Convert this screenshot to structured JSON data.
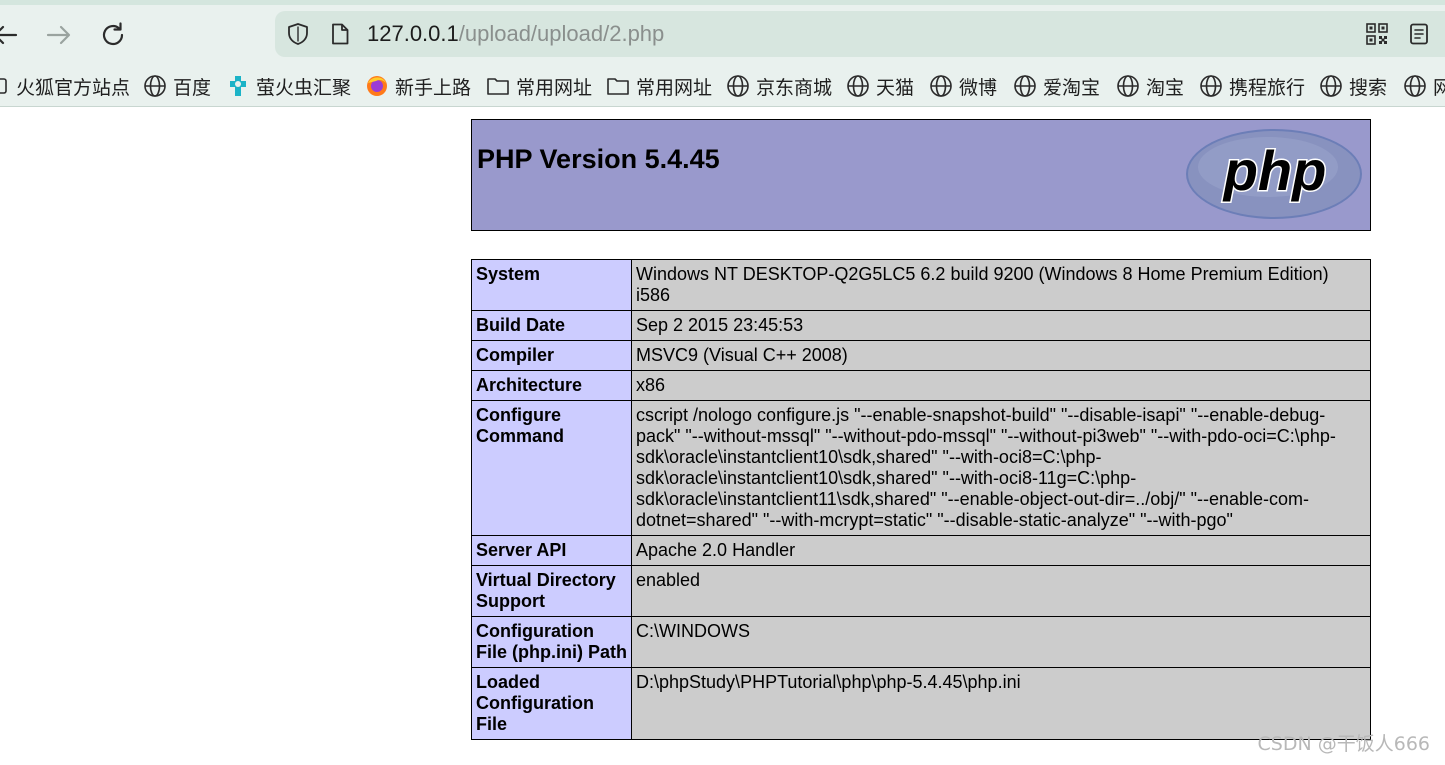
{
  "browser": {
    "url_host": "127.0.0.1",
    "url_path": "/upload/upload/2.php",
    "bookmarks": [
      {
        "label": "火狐官方站点",
        "icon": "folder-icon"
      },
      {
        "label": "百度",
        "icon": "globe-icon"
      },
      {
        "label": "萤火虫汇聚",
        "icon": "puzzle-icon"
      },
      {
        "label": "新手上路",
        "icon": "firefox-icon"
      },
      {
        "label": "常用网址",
        "icon": "folder-icon"
      },
      {
        "label": "常用网址",
        "icon": "folder-icon"
      },
      {
        "label": "京东商城",
        "icon": "globe-icon"
      },
      {
        "label": "天猫",
        "icon": "globe-icon"
      },
      {
        "label": "微博",
        "icon": "globe-icon"
      },
      {
        "label": "爱淘宝",
        "icon": "globe-icon"
      },
      {
        "label": "淘宝",
        "icon": "globe-icon"
      },
      {
        "label": "携程旅行",
        "icon": "globe-icon"
      },
      {
        "label": "搜索",
        "icon": "globe-icon"
      },
      {
        "label": "网",
        "icon": "globe-icon"
      }
    ]
  },
  "phpinfo": {
    "title": "PHP Version 5.4.45",
    "logo_text": "php",
    "rows": [
      {
        "key": "System",
        "value": "Windows NT DESKTOP-Q2G5LC5 6.2 build 9200 (Windows 8 Home Premium Edition) i586"
      },
      {
        "key": "Build Date",
        "value": "Sep 2 2015 23:45:53"
      },
      {
        "key": "Compiler",
        "value": "MSVC9 (Visual C++ 2008)"
      },
      {
        "key": "Architecture",
        "value": "x86"
      },
      {
        "key": "Configure Command",
        "value": "cscript /nologo configure.js \"--enable-snapshot-build\" \"--disable-isapi\" \"--enable-debug-pack\" \"--without-mssql\" \"--without-pdo-mssql\" \"--without-pi3web\" \"--with-pdo-oci=C:\\php-sdk\\oracle\\instantclient10\\sdk,shared\" \"--with-oci8=C:\\php-sdk\\oracle\\instantclient10\\sdk,shared\" \"--with-oci8-11g=C:\\php-sdk\\oracle\\instantclient11\\sdk,shared\" \"--enable-object-out-dir=../obj/\" \"--enable-com-dotnet=shared\" \"--with-mcrypt=static\" \"--disable-static-analyze\" \"--with-pgo\""
      },
      {
        "key": "Server API",
        "value": "Apache 2.0 Handler"
      },
      {
        "key": "Virtual Directory Support",
        "value": "enabled"
      },
      {
        "key": "Configuration File (php.ini) Path",
        "value": "C:\\WINDOWS"
      },
      {
        "key": "Loaded Configuration File",
        "value": "D:\\phpStudy\\PHPTutorial\\php\\php-5.4.45\\php.ini"
      }
    ]
  },
  "watermark": "CSDN @干饭人666",
  "colors": {
    "header_bg": "#9999cc",
    "key_cell_bg": "#ccccff",
    "value_cell_bg": "#cccccc",
    "chrome_bg": "#e9f1ee",
    "urlbar_bg": "#d7e6df"
  }
}
